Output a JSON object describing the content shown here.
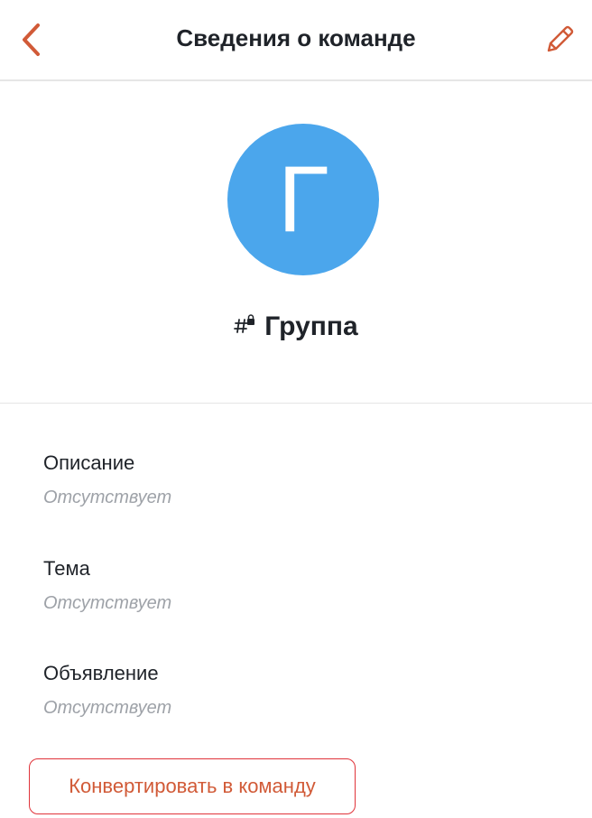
{
  "navbar": {
    "title": "Сведения о команде",
    "back_icon": "chevron-left-icon",
    "edit_icon": "pencil-icon"
  },
  "room": {
    "avatar_letter": "Г",
    "avatar_color": "#4ba6ec",
    "type_icon": "private-channel-icon",
    "name": "Группа"
  },
  "fields": [
    {
      "label": "Описание",
      "value": "Отсутствует"
    },
    {
      "label": "Тема",
      "value": "Отсутствует"
    },
    {
      "label": "Объявление",
      "value": "Отсутствует"
    }
  ],
  "actions": {
    "convert_label": "Конвертировать в команду"
  },
  "colors": {
    "accent": "#d15a37",
    "text": "#1f2329",
    "muted": "#9ea2a8",
    "danger_border": "#e0333a"
  }
}
